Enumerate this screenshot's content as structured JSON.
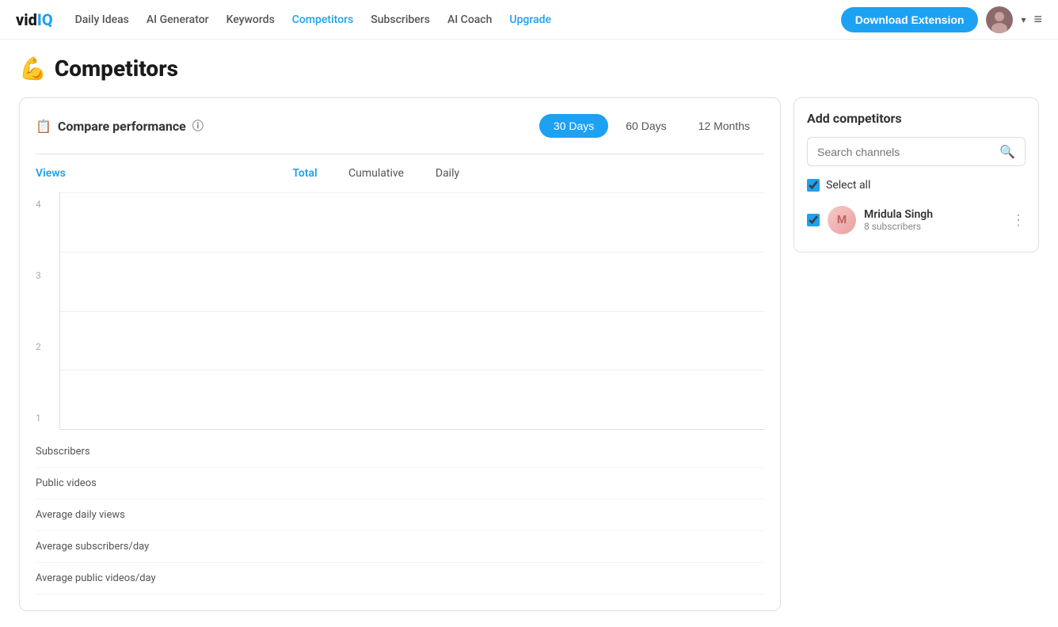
{
  "logo": {
    "vid": "vid",
    "iq": "IQ"
  },
  "nav": {
    "links": [
      {
        "label": "Daily Ideas",
        "active": false
      },
      {
        "label": "AI Generator",
        "active": false
      },
      {
        "label": "Keywords",
        "active": false
      },
      {
        "label": "Competitors",
        "active": true
      },
      {
        "label": "Subscribers",
        "active": false
      },
      {
        "label": "AI Coach",
        "active": false
      },
      {
        "label": "Upgrade",
        "active": false,
        "upgrade": true
      }
    ],
    "download_btn": "Download Extension"
  },
  "page": {
    "title": "Competitors",
    "icon": "💪"
  },
  "compare_panel": {
    "title": "Compare performance",
    "info_icon": "ⓘ",
    "time_tabs": [
      {
        "label": "30 Days",
        "active": true
      },
      {
        "label": "60 Days",
        "active": false
      },
      {
        "label": "12 Months",
        "active": false
      }
    ],
    "table_headers": {
      "label": "Views",
      "total": "Total",
      "cumulative": "Cumulative",
      "daily": "Daily"
    },
    "y_axis_labels": [
      "4",
      "3",
      "2",
      "1"
    ],
    "metric_rows": [
      {
        "label": "Subscribers"
      },
      {
        "label": "Public videos"
      },
      {
        "label": "Average daily views"
      },
      {
        "label": "Average subscribers/day"
      },
      {
        "label": "Average public videos/day"
      }
    ]
  },
  "sidebar": {
    "title": "Add competitors",
    "search_placeholder": "Search channels",
    "select_all_label": "Select all",
    "competitor": {
      "name": "Mridula Singh",
      "subscribers": "8 subscribers"
    }
  }
}
